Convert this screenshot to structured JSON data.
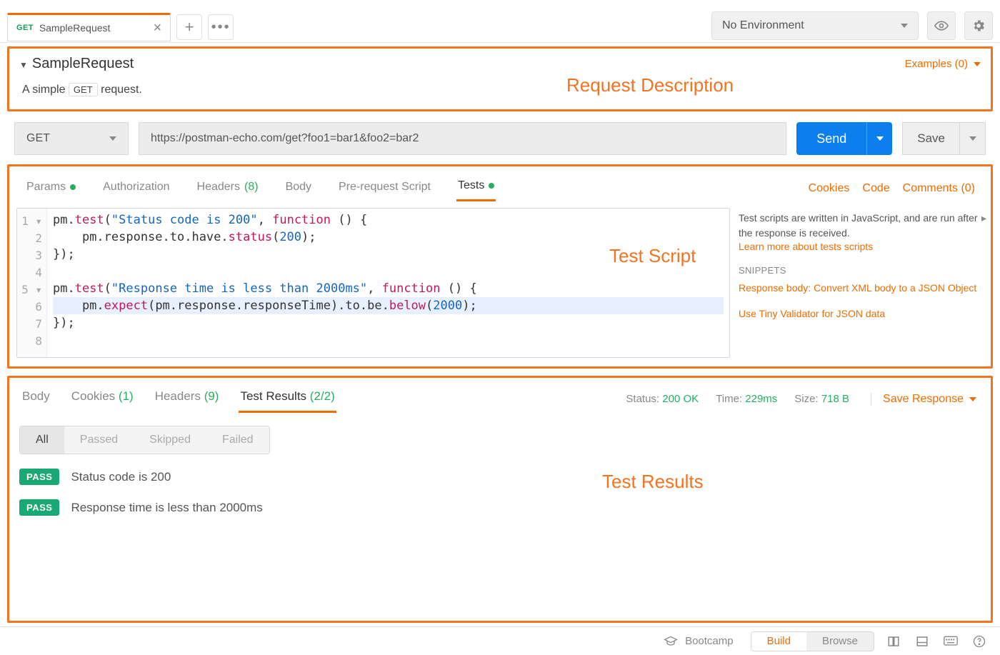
{
  "topbar": {
    "tab": {
      "method": "GET",
      "name": "SampleRequest"
    },
    "env_label": "No Environment"
  },
  "annotations": {
    "desc": "Request Description",
    "script": "Test Script",
    "results": "Test Results"
  },
  "request": {
    "title": "SampleRequest",
    "description_pre": "A simple",
    "description_code": "GET",
    "description_post": "request.",
    "examples_label": "Examples (0)",
    "method": "GET",
    "url": "https://postman-echo.com/get?foo1=bar1&foo2=bar2",
    "send": "Send",
    "save": "Save"
  },
  "req_tabs": {
    "params": "Params",
    "auth": "Authorization",
    "headers": "Headers",
    "headers_count": "(8)",
    "body": "Body",
    "prereq": "Pre-request Script",
    "tests": "Tests"
  },
  "right_links": {
    "cookies": "Cookies",
    "code": "Code",
    "comments": "Comments (0)"
  },
  "editor": {
    "lines": [
      "pm.test(\"Status code is 200\", function () {",
      "    pm.response.to.have.status(200);",
      "});",
      "",
      "pm.test(\"Response time is less than 2000ms\", function () {",
      "    pm.expect(pm.response.responseTime).to.be.below(2000);",
      "});",
      ""
    ]
  },
  "sidebar": {
    "info": "Test scripts are written in JavaScript, and are run after the response is received.",
    "learn": "Learn more about tests scripts",
    "snip_header": "SNIPPETS",
    "snip1": "Response body: Convert XML body to a JSON Object",
    "snip2": "Use Tiny Validator for JSON data"
  },
  "response": {
    "tabs": {
      "body": "Body",
      "cookies": "Cookies",
      "cookies_count": "(1)",
      "headers": "Headers",
      "headers_count": "(9)",
      "results": "Test Results",
      "results_count": "(2/2)"
    },
    "meta": {
      "status_label": "Status:",
      "status_value": "200 OK",
      "time_label": "Time:",
      "time_value": "229ms",
      "size_label": "Size:",
      "size_value": "718 B",
      "save_response": "Save Response"
    },
    "filters": {
      "all": "All",
      "passed": "Passed",
      "skipped": "Skipped",
      "failed": "Failed"
    },
    "results": [
      {
        "status": "PASS",
        "name": "Status code is 200"
      },
      {
        "status": "PASS",
        "name": "Response time is less than 2000ms"
      }
    ]
  },
  "statusbar": {
    "bootcamp": "Bootcamp",
    "build": "Build",
    "browse": "Browse"
  }
}
